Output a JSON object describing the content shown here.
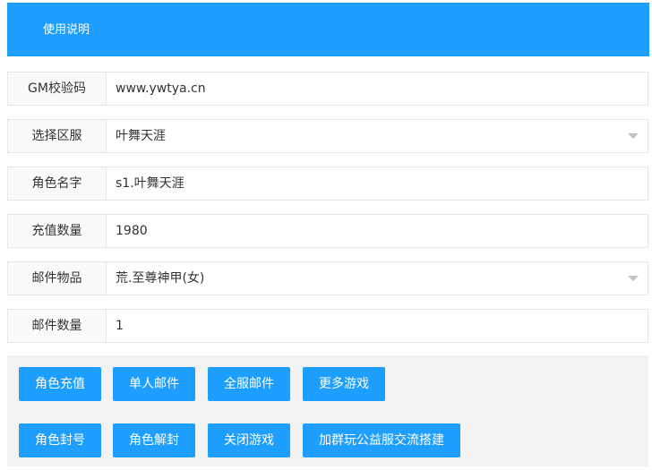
{
  "header": {
    "title": "使用说明"
  },
  "form": {
    "gm_code": {
      "label": "GM校验码",
      "value": "www.ywtya.cn"
    },
    "server": {
      "label": "选择区服",
      "value": "叶舞天涯"
    },
    "role_name": {
      "label": "角色名字",
      "value": "s1.叶舞天涯"
    },
    "recharge_amount": {
      "label": "充值数量",
      "value": "1980"
    },
    "mail_item": {
      "label": "邮件物品",
      "value": "荒.至尊神甲(女)"
    },
    "mail_count": {
      "label": "邮件数量",
      "value": "1"
    }
  },
  "buttons": {
    "role_recharge": "角色充值",
    "single_mail": "单人邮件",
    "all_server_mail": "全服邮件",
    "more_games": "更多游戏",
    "ban_role": "角色封号",
    "unban_role": "角色解封",
    "close_game": "关闭游戏",
    "join_group": "加群玩公益服交流搭建"
  },
  "colors": {
    "primary": "#1e9fff",
    "label_bg": "#fafafa",
    "border": "#e6e6e6",
    "panel_bg": "#f2f2f2"
  }
}
